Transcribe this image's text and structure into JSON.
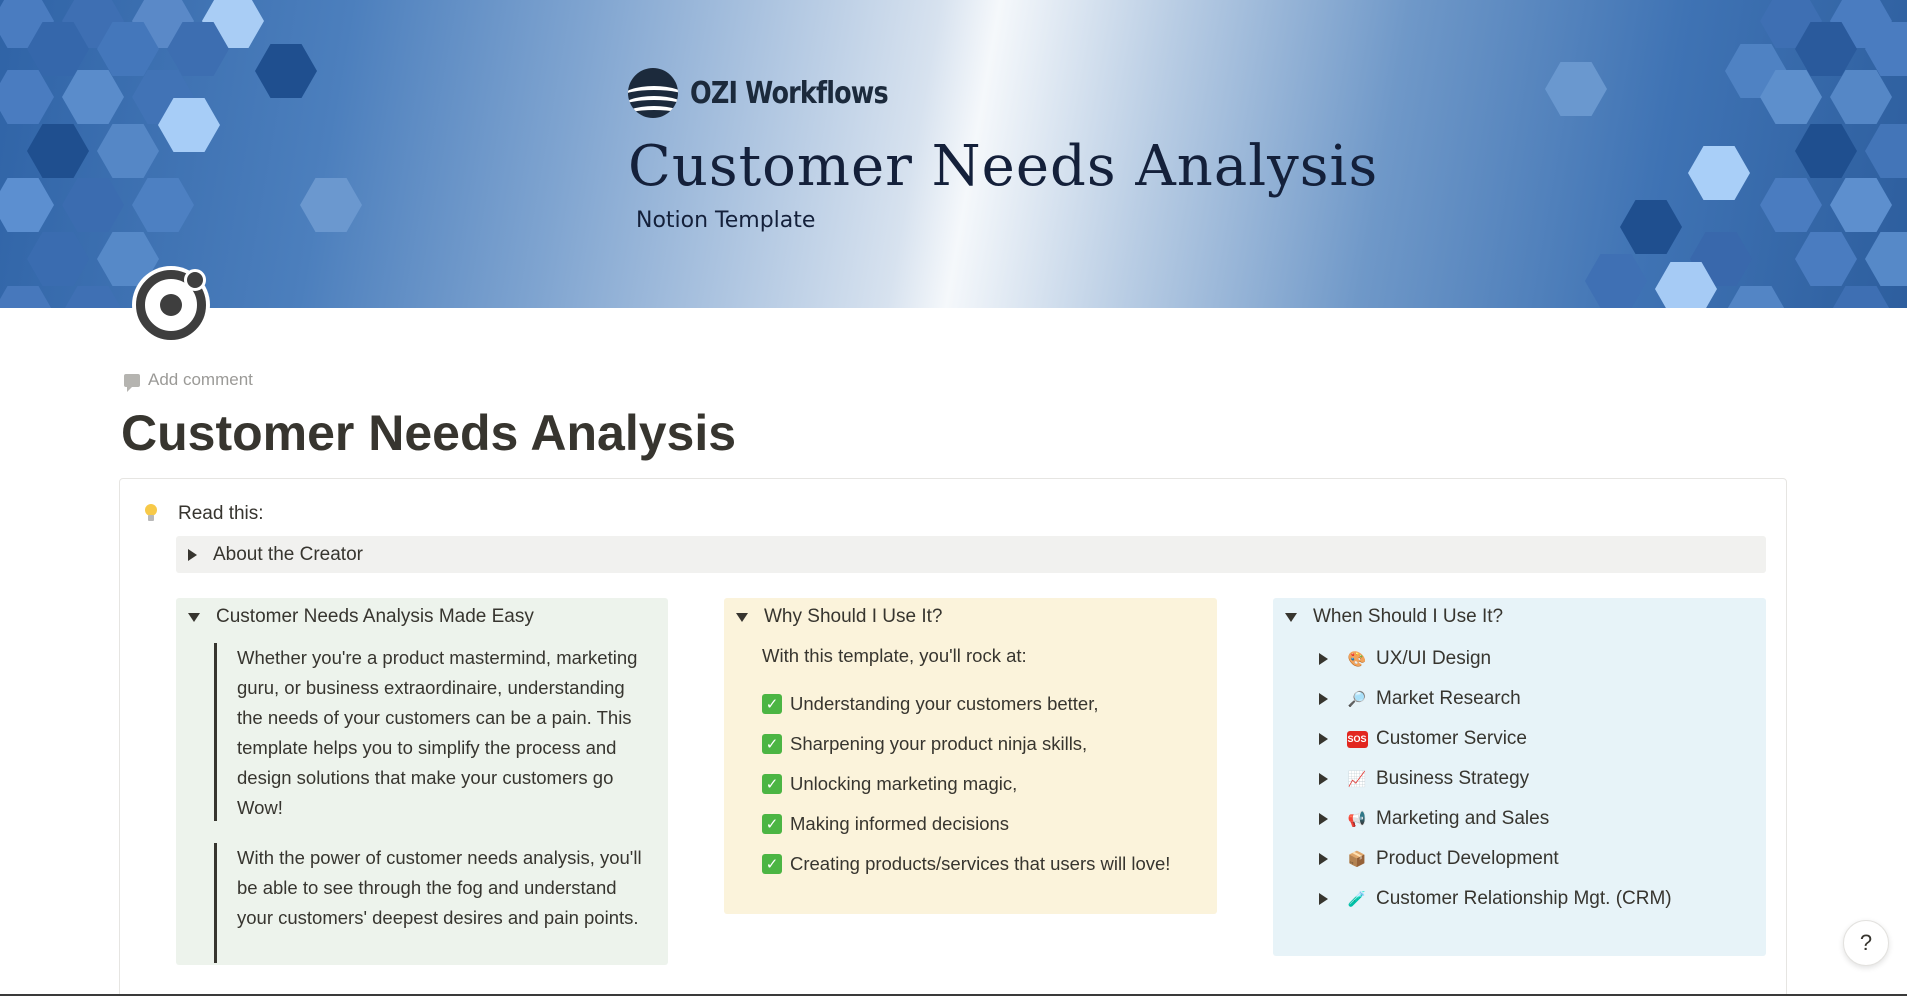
{
  "cover": {
    "brand": "OZI Workflows",
    "title": "Customer Needs Analysis",
    "subtitle": "Notion Template"
  },
  "header": {
    "add_comment": "Add comment",
    "page_title": "Customer Needs Analysis"
  },
  "callout": {
    "icon": "light-bulb-icon",
    "label": "Read this:",
    "about_toggle": "About the Creator",
    "made_easy": {
      "title": "Customer Needs Analysis Made Easy",
      "paragraphs": [
        "Whether you're a product mastermind, marketing guru, or business extraordinaire, understanding the needs of your customers can be a pain. This template helps you to simplify the process and design solutions that make your customers go Wow!",
        "With the power of customer needs analysis, you'll be able to see through the fog and understand your customers' deepest desires and pain points."
      ]
    },
    "why_use": {
      "title": "Why Should I Use It?",
      "intro": "With this template, you'll rock at:",
      "items": [
        "Understanding your customers better,",
        "Sharpening your product ninja skills,",
        "Unlocking marketing magic,",
        "Making informed decisions",
        "Creating products/services that users will love!"
      ]
    },
    "when_use": {
      "title": "When Should I Use It?",
      "items": [
        {
          "label": "UX/UI Design",
          "icon": "palette-icon"
        },
        {
          "label": "Market Research",
          "icon": "magnifier-icon"
        },
        {
          "label": "Customer Service",
          "icon": "sos-icon"
        },
        {
          "label": "Business Strategy",
          "icon": "chart-increasing-icon"
        },
        {
          "label": "Marketing and Sales",
          "icon": "megaphone-icon"
        },
        {
          "label": "Product Development",
          "icon": "package-icon"
        },
        {
          "label": "Customer Relationship Mgt. (CRM)",
          "icon": "test-tube-icon"
        }
      ]
    }
  },
  "help": {
    "label": "?"
  },
  "colors": {
    "callout_green": "#edf3ec",
    "callout_yellow": "#fbf3db",
    "callout_blue": "#e7f3f8",
    "toggle_gray": "#f1f1ef",
    "check_green": "#4bb543",
    "text": "#37352f"
  }
}
